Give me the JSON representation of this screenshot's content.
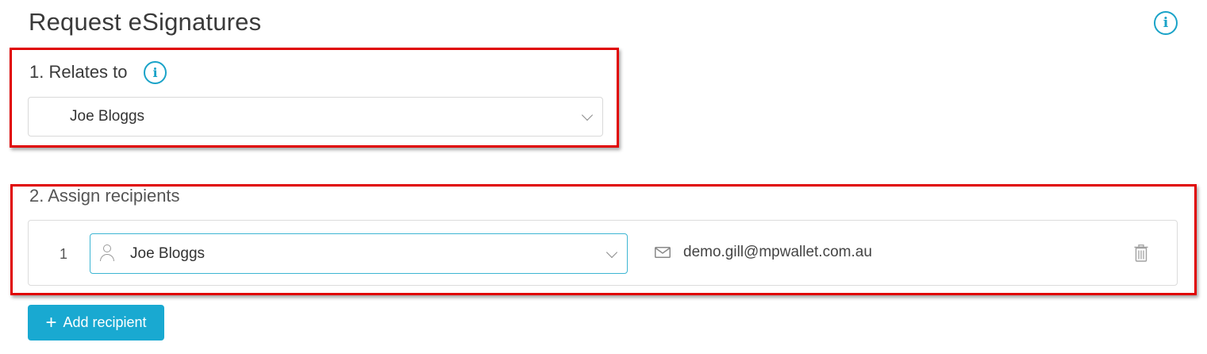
{
  "header": {
    "title": "Request eSignatures",
    "info_icon": "info-icon"
  },
  "relates_to": {
    "label": "1. Relates to",
    "info_icon": "info-icon",
    "selected_value": "Joe Bloggs",
    "dropdown_icon": "chevron-down-icon"
  },
  "assign_recipients": {
    "label": "2. Assign recipients",
    "recipients": [
      {
        "number": "1",
        "name": "Joe Bloggs",
        "email": "demo.gill@mpwallet.com.au",
        "person_icon": "person-icon",
        "email_icon": "mail-icon",
        "delete_icon": "trash-icon"
      }
    ]
  },
  "actions": {
    "add_recipient_label": "Add recipient",
    "add_icon": "plus-icon"
  },
  "colors": {
    "accent": "#19a9d1",
    "highlight": "#e00000",
    "text": "#3a3a3a"
  }
}
